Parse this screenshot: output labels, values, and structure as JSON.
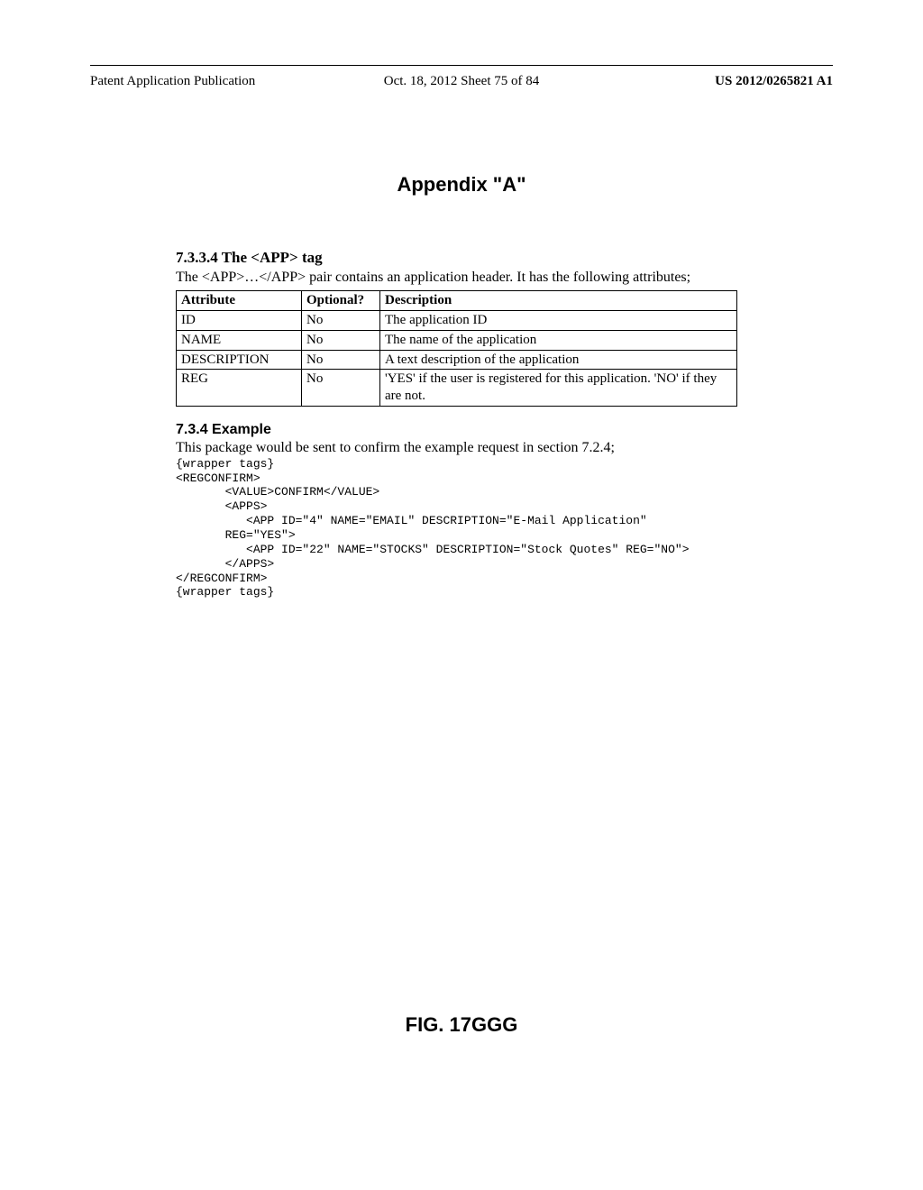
{
  "header": {
    "left": "Patent Application Publication",
    "center": "Oct. 18, 2012  Sheet 75 of 84",
    "right": "US 2012/0265821 A1"
  },
  "appendix_title": "Appendix \"A\"",
  "section_733_4": {
    "heading": "7.3.3.4  The <APP> tag",
    "intro": "The <APP>…</APP> pair contains an application header.  It has the following attributes;",
    "table": {
      "headers": {
        "attr": "Attribute",
        "opt": "Optional?",
        "desc": "Description"
      },
      "rows": [
        {
          "attr": "ID",
          "opt": "No",
          "desc": "The application ID"
        },
        {
          "attr": "NAME",
          "opt": "No",
          "desc": "The name of the application"
        },
        {
          "attr": "DESCRIPTION",
          "opt": "No",
          "desc": "A text description of the application"
        },
        {
          "attr": "REG",
          "opt": "No",
          "desc": "'YES' if the user is registered for this application. 'NO' if they are not."
        }
      ]
    }
  },
  "section_734": {
    "heading": "7.3.4  Example",
    "intro": "This package would be sent to confirm the example request in section 7.2.4;",
    "code": "{wrapper tags}\n<REGCONFIRM>\n       <VALUE>CONFIRM</VALUE>\n       <APPS>\n          <APP ID=\"4\" NAME=\"EMAIL\" DESCRIPTION=\"E-Mail Application\"\n       REG=\"YES\">\n          <APP ID=\"22\" NAME=\"STOCKS\" DESCRIPTION=\"Stock Quotes\" REG=\"NO\">\n       </APPS>\n</REGCONFIRM>\n{wrapper tags}"
  },
  "figure_label": "FIG. 17GGG"
}
